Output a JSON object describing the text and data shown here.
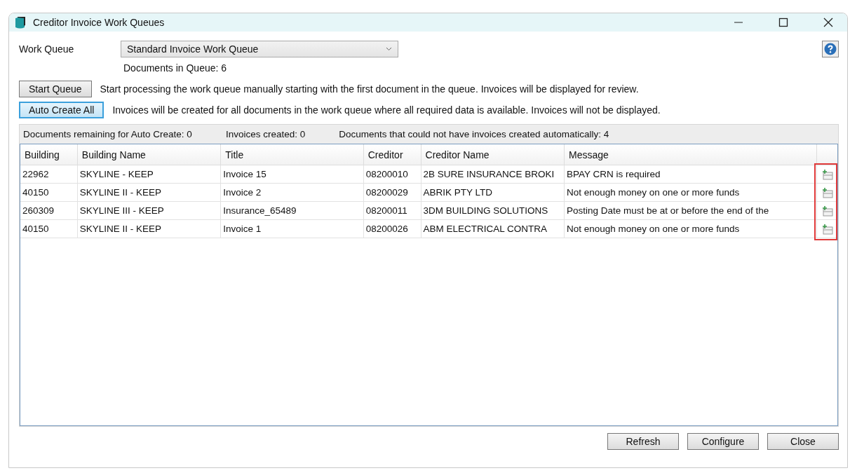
{
  "window": {
    "title": "Creditor Invoice Work Queues"
  },
  "work_queue": {
    "label": "Work Queue",
    "value": "Standard Invoice Work Queue",
    "documents_in_queue": "Documents in Queue: 6"
  },
  "actions": [
    {
      "button": "Start Queue",
      "description": "Start processing the work queue manually starting with the first document in the queue.  Invoices will be displayed for review.",
      "focused": false
    },
    {
      "button": "Auto Create All",
      "description": "Invoices will be created for all documents in the work queue where all required data is available.  Invoices will not be displayed.",
      "focused": true
    }
  ],
  "summary": [
    "Documents remaining for Auto Create: 0",
    "Invoices created: 0",
    "Documents that could not have invoices created automatically: 4"
  ],
  "table": {
    "columns": [
      "Building",
      "Building Name",
      "Title",
      "Creditor",
      "Creditor Name",
      "Message"
    ],
    "action_column_highlighted": true,
    "rows": [
      [
        "22962",
        "SKYLINE - KEEP",
        "Invoice 15",
        "08200010",
        "2B SURE INSURANCE BROKI",
        "BPAY CRN is required"
      ],
      [
        "40150",
        "SKYLINE II - KEEP",
        "Invoice 2",
        "08200029",
        "ABRIK PTY LTD",
        "Not enough money on one or more funds"
      ],
      [
        "260309",
        "SKYLINE III - KEEP",
        "Insurance_65489",
        "08200011",
        "3DM BUILDING SOLUTIONS",
        "Posting Date must be at or before the end of the"
      ],
      [
        "40150",
        "SKYLINE II - KEEP",
        "Invoice 1",
        "08200026",
        "ABM ELECTRICAL CONTRA",
        "Not enough money on one or more funds"
      ]
    ]
  },
  "buttons": [
    "Refresh",
    "Configure",
    "Close"
  ]
}
